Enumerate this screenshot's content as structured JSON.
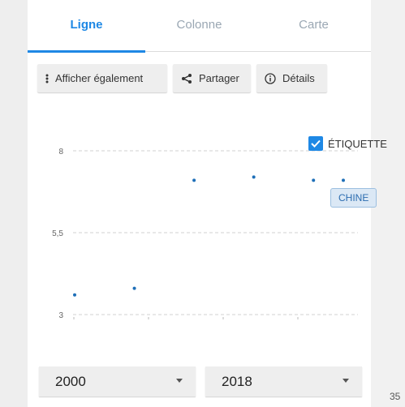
{
  "tabs": [
    {
      "label": "Ligne"
    },
    {
      "label": "Colonne"
    },
    {
      "label": "Carte"
    }
  ],
  "toolbar": {
    "show_also_label": "Afficher également",
    "share_label": "Partager",
    "details_label": "Détails"
  },
  "legend": {
    "label_checkbox": "ÉTIQUETTE",
    "checked": true,
    "series_tag": "CHINE"
  },
  "chart_data": {
    "type": "scatter",
    "x": [
      2000,
      2004,
      2008,
      2012,
      2016,
      2018
    ],
    "y": [
      3.6,
      3.8,
      7.1,
      7.2,
      7.1,
      7.1
    ],
    "ylim": [
      3,
      8
    ],
    "yticks": [
      "3",
      "5,5",
      "8"
    ],
    "grid": true,
    "color": "#1e6fb8"
  },
  "range": {
    "start": "2000",
    "end": "2018"
  },
  "page_number": "35"
}
